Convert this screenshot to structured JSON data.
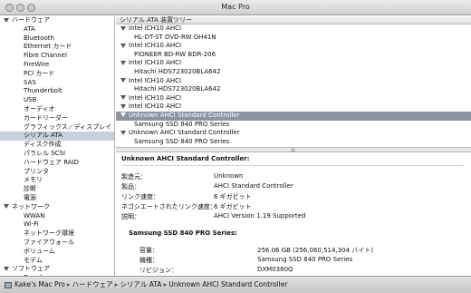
{
  "window": {
    "title": "Mac Pro"
  },
  "sidebar": {
    "items": [
      {
        "label": "ハードウェア",
        "kind": "group"
      },
      {
        "label": "ATA",
        "kind": "child"
      },
      {
        "label": "Bluetooth",
        "kind": "child"
      },
      {
        "label": "Ethernet カード",
        "kind": "child"
      },
      {
        "label": "Fibre Channel",
        "kind": "child"
      },
      {
        "label": "FireWire",
        "kind": "child"
      },
      {
        "label": "PCI カード",
        "kind": "child"
      },
      {
        "label": "SAS",
        "kind": "child"
      },
      {
        "label": "Thunderbolt",
        "kind": "child"
      },
      {
        "label": "USB",
        "kind": "child"
      },
      {
        "label": "オーディオ",
        "kind": "child"
      },
      {
        "label": "カードリーダー",
        "kind": "child"
      },
      {
        "label": "グラフィックス／ディスプレイ",
        "kind": "child"
      },
      {
        "label": "シリアル ATA",
        "kind": "child",
        "selected": true
      },
      {
        "label": "ディスク作成",
        "kind": "child"
      },
      {
        "label": "パラレル SCSI",
        "kind": "child"
      },
      {
        "label": "ハードウェア RAID",
        "kind": "child"
      },
      {
        "label": "プリンタ",
        "kind": "child"
      },
      {
        "label": "メモリ",
        "kind": "child"
      },
      {
        "label": "診断",
        "kind": "child"
      },
      {
        "label": "電源",
        "kind": "child"
      },
      {
        "label": "ネットワーク",
        "kind": "group"
      },
      {
        "label": "WWAN",
        "kind": "child"
      },
      {
        "label": "Wi-Fi",
        "kind": "child"
      },
      {
        "label": "ネットワーク環境",
        "kind": "child"
      },
      {
        "label": "ファイアウォール",
        "kind": "child"
      },
      {
        "label": "ボリューム",
        "kind": "child"
      },
      {
        "label": "モデム",
        "kind": "child"
      },
      {
        "label": "ソフトウェア",
        "kind": "group"
      },
      {
        "label": "Developer",
        "kind": "child"
      }
    ]
  },
  "tree": {
    "header": "シリアル ATA 装置ツリー",
    "rows": [
      {
        "label": "Intel ICH10 AHCI",
        "level": 0
      },
      {
        "label": "HL-DT-ST DVD-RW GH41N",
        "level": 1
      },
      {
        "label": "Intel ICH10 AHCI",
        "level": 0
      },
      {
        "label": "PIONEER BD-RW   BDR-206",
        "level": 1
      },
      {
        "label": "Intel ICH10 AHCI",
        "level": 0
      },
      {
        "label": "Hitachi HDS723020BLA642",
        "level": 1
      },
      {
        "label": "Intel ICH10 AHCI",
        "level": 0
      },
      {
        "label": "Hitachi HDS723020BLA642",
        "level": 1
      },
      {
        "label": "Intel ICH10 AHCI",
        "level": 0
      },
      {
        "label": "Intel ICH10 AHCI",
        "level": 0
      },
      {
        "label": "Unknown AHCI Standard Controller",
        "level": 0,
        "selected": true
      },
      {
        "label": "Samsung SSD 840 PRO Series",
        "level": 1
      },
      {
        "label": "Unknown AHCI Standard Controller",
        "level": 0
      },
      {
        "label": "Samsung SSD 840 PRO Series",
        "level": 1
      }
    ]
  },
  "detail": {
    "title": "Unknown AHCI Standard Controller:",
    "props": [
      {
        "key": "製造元：",
        "value": "Unknown"
      },
      {
        "key": "製品：",
        "value": "AHCI Standard Controller"
      },
      {
        "key": "リンク速度：",
        "value": "6 ギガビット"
      },
      {
        "key": "ネゴシエートされたリンク速度：",
        "value": "6 ギガビット"
      },
      {
        "key": "説明：",
        "value": "AHCI Version 1.19 Supported"
      }
    ],
    "sub_title": "Samsung SSD 840 PRO Series:",
    "sub_props": [
      {
        "key": "容量：",
        "value": "256.06 GB (256,060,514,304 バイト)"
      },
      {
        "key": "機種：",
        "value": "Samsung SSD 840 PRO Series"
      },
      {
        "key": "リビジョン：",
        "value": "DXM0380Q"
      }
    ]
  },
  "statusbar": {
    "path": [
      "Kake's Mac Pro",
      "ハードウェア",
      "シリアル ATA",
      "Unknown AHCI Standard Controller"
    ],
    "separator": "▸"
  }
}
